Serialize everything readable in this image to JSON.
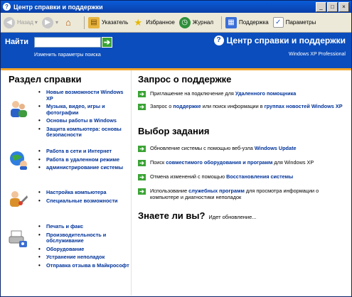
{
  "window": {
    "title": "Центр справки и поддержки",
    "buttons": [
      "_",
      "□",
      "×"
    ]
  },
  "toolbar": {
    "back": "Назад",
    "items": [
      {
        "label": "Указатель",
        "icon": "index-icon"
      },
      {
        "label": "Избранное",
        "icon": "favorites-star-icon"
      },
      {
        "label": "Журнал",
        "icon": "history-icon"
      },
      {
        "label": "Поддержка",
        "icon": "support-icon"
      },
      {
        "label": "Параметры",
        "icon": "options-icon"
      }
    ]
  },
  "search": {
    "label": "Найти",
    "value": "",
    "go": "➔",
    "options_link": "Изменить параметры поиска"
  },
  "header": {
    "title": "Центр справки и поддержки",
    "subtitle": "Windows XP Professional"
  },
  "left": {
    "title": "Раздел справки",
    "groups": [
      {
        "icon": "users-icon",
        "items": [
          "Новые возможности Windows XP",
          "Музыка, видео, игры и фотографии",
          "Основы работы в Windows",
          "Защита компьютера: основы безопасности"
        ]
      },
      {
        "icon": "network-icon",
        "items": [
          "Работа в сети и Интернет",
          "Работа в удаленном режиме",
          "администрирование системы"
        ]
      },
      {
        "icon": "tools-icon",
        "items": [
          "Настройка компьютера",
          "Специальные возможности"
        ]
      },
      {
        "icon": "printer-icon",
        "items": [
          "Печать и факс",
          "Производительность и обслуживание",
          "Оборудование",
          "Устранение неполадок",
          "Отправка отзыва в Майкрософт"
        ]
      }
    ]
  },
  "support": {
    "title": "Запрос о поддержке",
    "items": [
      {
        "pre": "Приглашение на подключение для ",
        "bold": "Удаленного помощника",
        "post": ""
      },
      {
        "pre": "Запрос о ",
        "bold": "поддержке",
        "post": " или поиск информации в ",
        "bold2": "группах новостей Windows XP"
      }
    ]
  },
  "tasks": {
    "title": "Выбор задания",
    "items": [
      {
        "pre": "Обновление системы с помощью веб-узла ",
        "bold": "Windows Update",
        "post": ""
      },
      {
        "pre": "Поиск ",
        "bold": "совместимого оборудования и программ",
        "post": " для Windows XP"
      },
      {
        "pre": "Отмена изменений с помощью ",
        "bold": "Восстановления системы",
        "post": ""
      },
      {
        "pre": "Использование ",
        "bold": "служебных программ",
        "post": " для просмотра информации о компьютере и диагностики неполадок"
      }
    ]
  },
  "didyouknow": {
    "title": "Знаете ли вы?",
    "status": "Идет обновление..."
  }
}
